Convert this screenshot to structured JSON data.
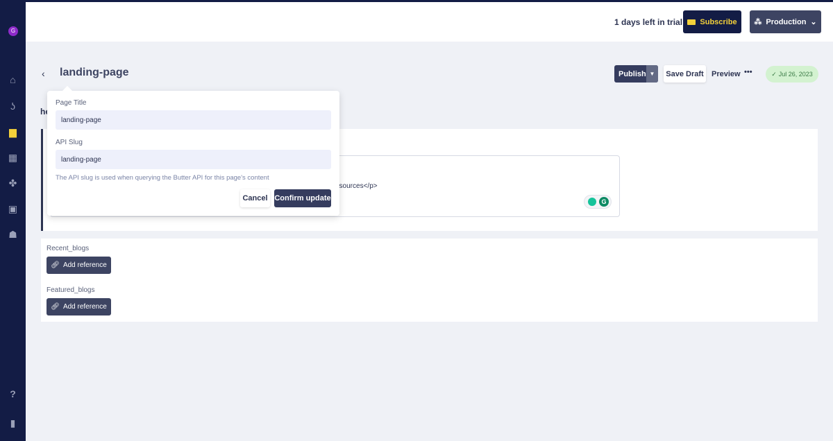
{
  "sidebar": {
    "avatar_initial": "G",
    "items": [
      "home-icon",
      "blog-icon",
      "pages-icon",
      "collections-icon",
      "components-icon",
      "media-icon",
      "users-icon"
    ],
    "bottom": [
      "help-icon",
      "docs-icon"
    ]
  },
  "topbar": {
    "trial_text": "1 days left in trial",
    "subscribe_label": "Subscribe",
    "environment_label": "Production"
  },
  "header": {
    "title": "landing-page",
    "publish_label": "Publish",
    "save_draft_label": "Save Draft",
    "preview_label": "Preview",
    "more_label": "•••",
    "date_badge": "Jul 26, 2023",
    "badge_color": "#d3f2d0"
  },
  "content": {
    "section_label_fragment": "he",
    "textarea_fragment": "esources</p>",
    "reference_fields": [
      {
        "label": "Recent_blogs",
        "button": "Add reference"
      },
      {
        "label": "Featured_blogs",
        "button": "Add reference"
      }
    ]
  },
  "popover": {
    "page_title_label": "Page Title",
    "page_title_value": "landing-page",
    "api_slug_label": "API Slug",
    "api_slug_value": "landing-page",
    "hint": "The API slug is used when querying the Butter API for this page's content",
    "cancel_label": "Cancel",
    "confirm_label": "Confirm update"
  }
}
